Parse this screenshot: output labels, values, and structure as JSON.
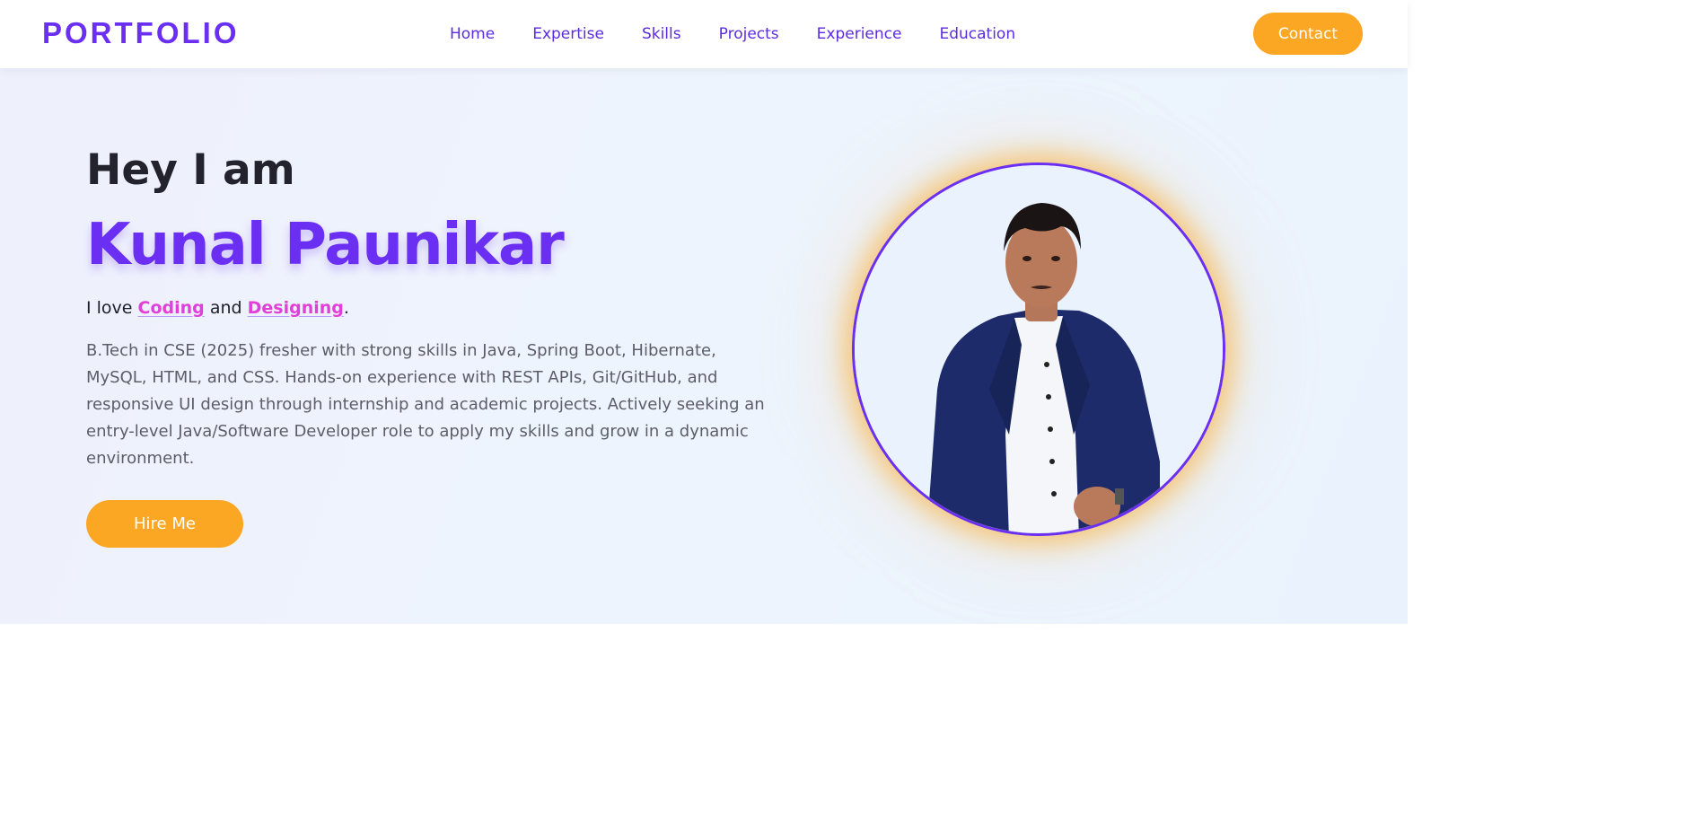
{
  "brand": "PORTFOLIO",
  "nav": {
    "items": [
      "Home",
      "Expertise",
      "Skills",
      "Projects",
      "Experience",
      "Education"
    ],
    "contact_label": "Contact"
  },
  "hero": {
    "greeting": "Hey I am",
    "name": "Kunal Paunikar",
    "tagline": {
      "prefix": "I love ",
      "highlight1": "Coding",
      "middle": " and ",
      "highlight2": "Designing",
      "suffix": "."
    },
    "bio": "B.Tech in CSE (2025) fresher with strong skills in Java, Spring Boot, Hibernate, MySQL, HTML, and CSS. Hands-on experience with REST APIs, Git/GitHub, and responsive UI design through internship and academic projects. Actively seeking an entry-level Java/Software Developer role to apply my skills and grow in a dynamic environment.",
    "hire_label": "Hire Me",
    "photo_icon": "profile-photo"
  },
  "colors": {
    "accent": "#6a2ff2",
    "button": "#fca723",
    "highlight": "#e040d8"
  }
}
